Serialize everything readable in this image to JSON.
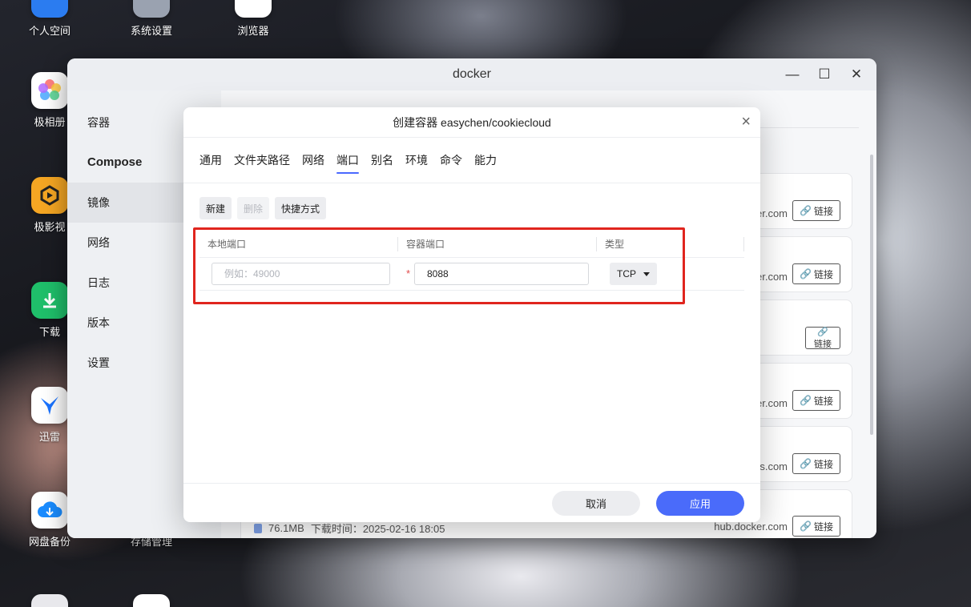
{
  "desktop": {
    "icons": [
      {
        "label": "个人空间"
      },
      {
        "label": "系统设置"
      },
      {
        "label": "浏览器"
      },
      {
        "label": "极相册"
      },
      {
        "label": "极影视"
      },
      {
        "label": "下载"
      },
      {
        "label": "迅雷"
      },
      {
        "label": "网盘备份"
      },
      {
        "label": "存储管理"
      }
    ]
  },
  "window": {
    "title": "docker",
    "controls": {
      "minimize": "—",
      "maximize": "☐",
      "close": "✕"
    }
  },
  "sidebar": {
    "items": [
      {
        "label": "容器"
      },
      {
        "label": "Compose"
      },
      {
        "label": "镜像"
      },
      {
        "label": "网络"
      },
      {
        "label": "日志"
      },
      {
        "label": "版本"
      },
      {
        "label": "设置"
      }
    ]
  },
  "cards": [
    {
      "host": "cker.com",
      "link_label": "链接"
    },
    {
      "host": "cker.com",
      "link_label": "链接"
    },
    {
      "host": "",
      "link_label": "链接"
    },
    {
      "host": "cker.com",
      "link_label": "链接"
    },
    {
      "host": "s.com",
      "link_label": "链接"
    },
    {
      "host": "hub.docker.com",
      "link_label": "链接",
      "size": "76.1MB",
      "download_time": "下载时间：2025-02-16 18:05"
    }
  ],
  "modal": {
    "title": "创建容器 easychen/cookiecloud",
    "close": "×",
    "tabs": [
      {
        "label": "通用"
      },
      {
        "label": "文件夹路径"
      },
      {
        "label": "网络"
      },
      {
        "label": "端口"
      },
      {
        "label": "别名"
      },
      {
        "label": "环境"
      },
      {
        "label": "命令"
      },
      {
        "label": "能力"
      }
    ],
    "active_tab": "端口",
    "toolbar": {
      "new": "新建",
      "delete": "删除",
      "shortcut": "快捷方式"
    },
    "table": {
      "headers": {
        "local_port": "本地端口",
        "container_port": "容器端口",
        "type": "类型"
      },
      "row": {
        "local_port_placeholder": "例如：49000",
        "required_mark": "*",
        "container_port": "8088",
        "type": "TCP"
      }
    },
    "footer": {
      "cancel": "取消",
      "apply": "应用"
    }
  },
  "colors": {
    "accent": "#4a6bfa",
    "highlight": "#e0251e"
  }
}
